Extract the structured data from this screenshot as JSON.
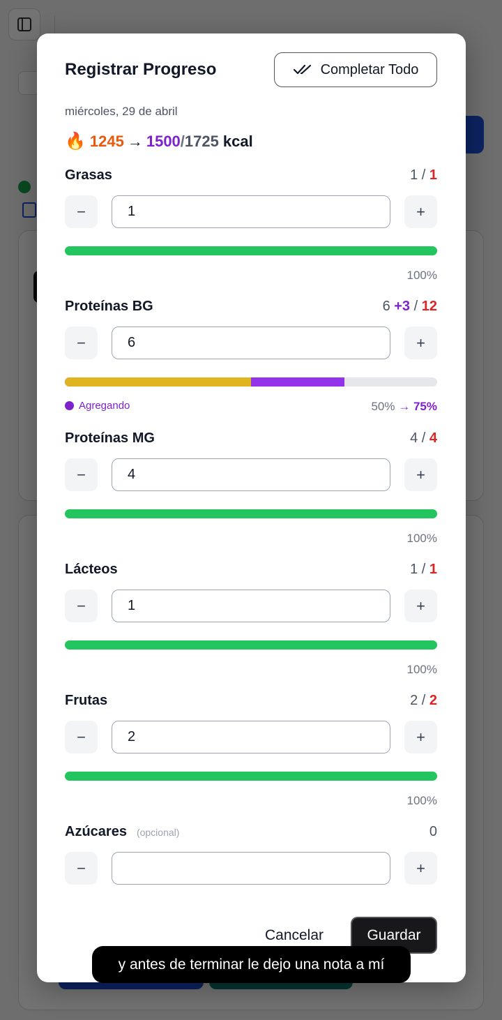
{
  "modal": {
    "title": "Registrar Progreso",
    "complete_all_label": "Completar Todo",
    "date": "miércoles, 29 de abril",
    "kcal": {
      "current": "1245",
      "arrow": "→",
      "projected": "1500",
      "slash": "/",
      "goal": "1725",
      "unit": "kcal"
    },
    "sections": [
      {
        "label": "Grasas",
        "current": "1",
        "sep": "/",
        "target": "1",
        "value": "1",
        "progress_pct": 100,
        "pct_label": "100%"
      },
      {
        "label": "Proteínas BG",
        "current": "6",
        "added": "+3",
        "sep": "/",
        "target": "12",
        "value": "6",
        "progress_pct": 50,
        "projected_pct": 75,
        "pct_label": "50%",
        "pct_arrow": "→",
        "projected_pct_label": "75%",
        "adding_label": "Agregando"
      },
      {
        "label": "Proteínas MG",
        "current": "4",
        "sep": "/",
        "target": "4",
        "value": "4",
        "progress_pct": 100,
        "pct_label": "100%"
      },
      {
        "label": "Lácteos",
        "current": "1",
        "sep": "/",
        "target": "1",
        "value": "1",
        "progress_pct": 100,
        "pct_label": "100%"
      },
      {
        "label": "Frutas",
        "current": "2",
        "sep": "/",
        "target": "2",
        "value": "2",
        "progress_pct": 100,
        "pct_label": "100%"
      },
      {
        "label": "Azúcares",
        "optional_label": "(opcional)",
        "current": "0",
        "value": ""
      }
    ],
    "stepper": {
      "minus": "−",
      "plus": "+"
    },
    "cancel_label": "Cancelar",
    "save_label": "Guardar"
  },
  "caption": "y antes de terminar le dejo una nota a mí",
  "colors": {
    "complete": "#22c55e",
    "current_partial": "#e0b321",
    "adding": "#9333ea",
    "track": "#e5e7eb",
    "target": "#dc2626"
  },
  "icons": {
    "complete_all": "double-check-icon",
    "calories": "fire-icon",
    "sidebar": "sidebar-toggle-icon"
  }
}
